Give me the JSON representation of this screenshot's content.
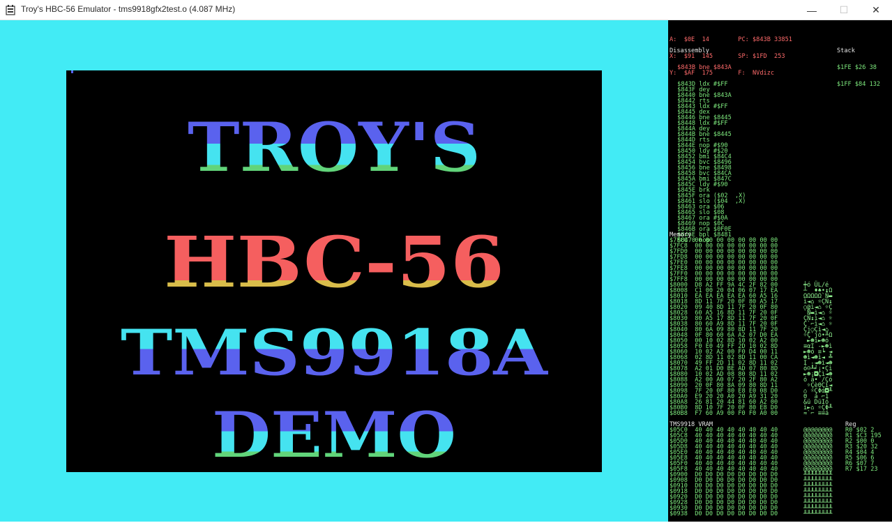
{
  "window": {
    "title": "Troy's HBC-56 Emulator - tms9918gfx2test.o (4.087 MHz)",
    "min_glyph": "—",
    "max_glyph": "☐",
    "close_glyph": "✕"
  },
  "screen": {
    "lines": [
      "TROY'S",
      "HBC-56",
      "TMS9918A",
      "DEMO"
    ],
    "colors": {
      "background": "#42ebf5",
      "blue": "#5a62ee",
      "cyan": "#45e3f0",
      "green": "#61d47a",
      "red": "#f55f5f",
      "yellow": "#d9bd4a"
    }
  },
  "registers": [
    "A:  $0E  14        PC: $843B 33851",
    "X:  $91  145       SP: $1FD  253",
    "Y:  $AF  175       F:  NVdizc"
  ],
  "disassembly": {
    "title": "Disassembly",
    "current": " $843B bne $843A",
    "lines": [
      " $843D ldx #$FF",
      " $843F dey",
      " $8440 bne $843A",
      " $8442 rts",
      " $8443 ldx #$FF",
      " $8445 dex",
      " $8446 bne $8445",
      " $8448 ldx #$FF",
      " $844A dey",
      " $844B bne $8445",
      " $844D rts",
      " $844E nop #$90",
      " $8450 ldy #$20",
      " $8452 bmi $84C4",
      " $8454 bvc $8496",
      " $8456 bne $8498",
      " $8458 bvc $84CA",
      " $845A bmi $847C",
      " $845C ldy #$90",
      " $845E brk",
      " $845F ora ($02  ,X)",
      " $8461 slo ($04  ,X)",
      " $8463 ora $06",
      " $8465 slo $08",
      " $8467 ora #$0A",
      " $8469 nop $0C",
      " $846B ora $0F0E",
      " $846E bpl $8481",
      " $8470 nop"
    ]
  },
  "stack": {
    "title": "Stack",
    "lines": [
      "$1FE $26 38",
      "$1FF $84 132"
    ]
  },
  "memory": {
    "title": "Memory",
    "lines": [
      "$7FC0  00 00 00 00 00 00 00 00",
      "$7FC8  00 00 00 00 00 00 00 00",
      "$7FD0  00 00 00 00 00 00 00 00",
      "$7FD8  00 00 00 00 00 00 00 00",
      "$7FE0  00 00 00 00 00 00 00 00",
      "$7FE8  00 00 00 00 00 00 00 00",
      "$7FF0  00 00 00 00 00 00 00 00",
      "$7FF8  00 00 00 00 00 00 00 00",
      "$8000  D8 A2 FF 9A 4C 2F 82 00",
      "$8008  C1 00 20 04 06 07 17 EA",
      "$8010  EA EA EA EA EA 60 A5 16",
      "$8018  8D 11 7F 20 0F 80 A5 17",
      "$8020  09 40 8D 11 7F 20 0F 80",
      "$8028  60 A5 16 8D 11 7F 20 0F",
      "$8030  80 A5 17 8D 11 7F 20 0F",
      "$8038  80 60 A9 8D 11 7F 20 0F",
      "$8040  80 6A 09 80 8D 11 7F 20",
      "$8048  0F 80 60 6A A2 07 D0 EA",
      "$8050  00 10 02 8D 10 02 A2 00",
      "$8058  F0 E0 49 FF 2D 10 02 8D",
      "$8060  10 02 A2 00 F0 D4 00 11",
      "$8068  02 8D 11 02 8D 11 00 CA",
      "$8070  49 FF 2D 11 02 8D 11 02",
      "$8078  A2 01 D0 BE AD 07 80 8D",
      "$8080  10 02 AD 08 80 8D 11 02",
      "$8088  A2 00 A0 07 20 2F 80 A2",
      "$8090  20 0F 80 8A 09 80 8D 11",
      "$8098  7F 20 0F 80 E8 E0 08 D0",
      "$80A0  E9 20 20 A0 20 A9 31 20",
      "$80A8  26 81 20 44 81 60 A2 00",
      "$80B0  8D 10 7F 20 0F 80 E8 D0",
      "$80B8  F7 60 A9 00 F0 F0 A0 00"
    ],
    "ascii": [
      "",
      "",
      "",
      "",
      "",
      "",
      "",
      "",
      "╪ó ÜL/é",
      "┴  ♦♠•↨Ω",
      "ΩΩΩΩΩ`Ñ▬",
      "ì◄⌂ ☼ÇÑ↨",
      "○@ì◄⌂ ☼Ç",
      "`Ñ▬ì◄⌂ ☼",
      "ÇÑ↨ì◄⌂ ☼",
      "Ç`⌐ì◄⌂ ☼",
      "Çj○Çì◄⌂ ",
      "☼Ç`jó•╨Ω",
      " ►☻ì►☻ó ",
      "≡αI -►☻ì",
      "►☻ó ≡╘ ◄",
      "☻ì◄☻ì◄ ╩",
      "I -◄☻ì◄☻",
      "ó☺╨╛¡•Çì",
      "►☻¡◘Çì◄☻",
      "ó á• /Çó",
      " ☼ÇèΘÇì◄",
      "⌂ ☼ÇΦα◘╨",
      "Θ  á ⌐1 ",
      "&ü DüIó ",
      "ì►⌂ ☼ÇΦ╨",
      "≈`⌐ ≡≡á "
    ]
  },
  "vram": {
    "title": "TMS9918 VRAM",
    "lines": [
      "$05C0  40 40 40 40 40 40 40 40",
      "$05C8  40 40 40 40 40 40 40 40",
      "$05D0  40 40 40 40 40 40 40 40",
      "$05D8  40 40 40 40 40 40 40 40",
      "$05E0  40 40 40 40 40 40 40 40",
      "$05E8  40 40 40 40 40 40 40 40",
      "$05F0  40 40 40 40 40 40 40 40",
      "$05F8  40 40 40 40 40 40 40 40",
      "$0900  D0 D0 D0 D0 D0 D0 D0 D0",
      "$0908  D0 D0 D0 D0 D0 D0 D0 D0",
      "$0910  D0 D0 D0 D0 D0 D0 D0 D0",
      "$0918  D0 D0 D0 D0 D0 D0 D0 D0",
      "$0920  D0 D0 D0 D0 D0 D0 D0 D0",
      "$0928  D0 D0 D0 D0 D0 D0 D0 D0",
      "$0930  D0 D0 D0 D0 D0 D0 D0 D0",
      "$0938  D0 D0 D0 D0 D0 D0 D0 D0"
    ],
    "ascii": [
      "@@@@@@@@",
      "@@@@@@@@",
      "@@@@@@@@",
      "@@@@@@@@",
      "@@@@@@@@",
      "@@@@@@@@",
      "@@@@@@@@",
      "@@@@@@@@",
      "╨╨╨╨╨╨╨╨",
      "╨╨╨╨╨╨╨╨",
      "╨╨╨╨╨╨╨╨",
      "╨╨╨╨╨╨╨╨",
      "╨╨╨╨╨╨╨╨",
      "╨╨╨╨╨╨╨╨",
      "╨╨╨╨╨╨╨╨",
      "╨╨╨╨╨╨╨╨"
    ]
  },
  "vdp_regs": {
    "title": "Reg",
    "lines": [
      "R0 $02 2",
      "R1 $C3 195",
      "R2 $00 0",
      "R3 $20 32",
      "R4 $04 4",
      "R5 $06 6",
      "R6 $07 7",
      "R7 $17 23"
    ]
  }
}
